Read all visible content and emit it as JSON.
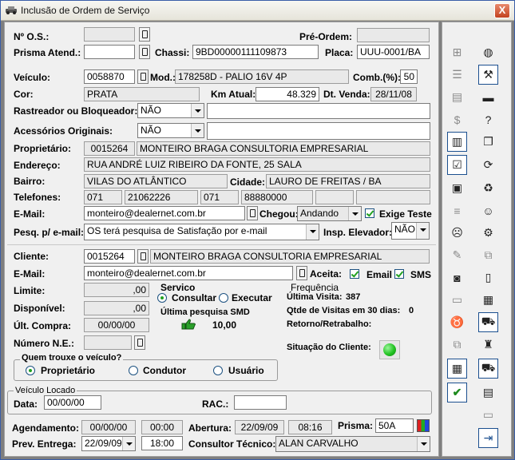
{
  "window": {
    "title": "Inclusão de Ordem de Serviço",
    "close": "X"
  },
  "labels": {
    "os": "Nº O.S.:",
    "pre_ordem": "Pré-Ordem:",
    "prisma_atend": "Prisma Atend.:",
    "chassi": "Chassi:",
    "placa": "Placa:",
    "veiculo": "Veículo:",
    "mod": "Mod.:",
    "comb": "Comb.(%):",
    "cor": "Cor:",
    "km_atual": "Km Atual:",
    "dt_venda": "Dt. Venda:",
    "rastreador": "Rastreador ou Bloqueador:",
    "acessorios": "Acessórios Originais:",
    "proprietario": "Proprietário:",
    "endereco": "Endereço:",
    "bairro": "Bairro:",
    "cidade": "Cidade:",
    "telefones": "Telefones:",
    "email": "E-Mail:",
    "chegou": "Chegou:",
    "exige_teste": "Exige Teste",
    "pesq_email": "Pesq. p/ e-mail:",
    "insp_elevador": "Insp. Elevador:",
    "cliente": "Cliente:",
    "email2": "E-Mail:",
    "aceita": "Aceita:",
    "email_chk": "Email",
    "sms_chk": "SMS",
    "limite": "Limite:",
    "disponivel": "Disponível:",
    "ult_compra": "Últ. Compra:",
    "numero_ne": "Número N.E.:",
    "servico": "Servico",
    "consultar": "Consultar",
    "executar": "Executar",
    "ultima_pesquisa": "Última pesquisa SMD",
    "frequencia": "Frequência",
    "ultima_visita": "Última Visita:",
    "qtde_visitas": "Qtde de Visitas em 30 dias:",
    "retorno": "Retorno/Retrabalho:",
    "situacao": "Situação do Cliente:",
    "quem_trouxe": "Quem trouxe o veículo?",
    "proprietario_opt": "Proprietário",
    "condutor_opt": "Condutor",
    "usuario_opt": "Usuário",
    "veiculo_locado": "Veículo Locado",
    "data": "Data:",
    "rac": "RAC.:",
    "agendamento": "Agendamento:",
    "abertura": "Abertura:",
    "prisma": "Prisma:",
    "prev_entrega": "Prev. Entrega:",
    "consultor": "Consultor Técnico:"
  },
  "values": {
    "chassi": "9BD00000111109873",
    "placa": "UUU-0001/BA",
    "veiculo": "0058870",
    "mod": "178258D - PALIO 16V 4P",
    "comb": "50",
    "cor": "PRATA",
    "km_atual": "48.329",
    "dt_venda": "28/11/08",
    "rastreador": "NÃO",
    "acessorios": "NÃO",
    "prop_code": "0015264",
    "prop_name": "MONTEIRO BRAGA CONSULTORIA EMPRESARIAL",
    "endereco": "RUA ANDRÉ LUIZ RIBEIRO DA FONTE, 25 SALA",
    "bairro": "VILAS DO ATLÂNTICO",
    "cidade": "LAURO DE FREITAS / BA",
    "tel1_ddd": "071",
    "tel1": "21062226",
    "tel2_ddd": "071",
    "tel2": "88880000",
    "email": "monteiro@dealernet.com.br",
    "chegou": "Andando",
    "pesq_email": "OS terá pesquisa de Satisfação por e-mail",
    "insp_elevador": "NÃO",
    "cliente_code": "0015264",
    "cliente_name": "MONTEIRO BRAGA CONSULTORIA EMPRESARIAL",
    "cliente_email": "monteiro@dealernet.com.br",
    "limite": ",00",
    "disponivel": ",00",
    "ult_compra": "00/00/00",
    "ultima_pesquisa_valor": "10,00",
    "ultima_visita": "387",
    "qtde_visitas": "0",
    "data_locado": "00/00/00",
    "agend_data": "00/00/00",
    "agend_hora": "00:00",
    "abertura_data": "22/09/09",
    "abertura_hora": "08:16",
    "prisma": "50A",
    "prev_data": "22/09/09",
    "prev_hora": "18:00",
    "consultor": "ALAN CARVALHO"
  },
  "colors": {
    "status_light": "#22c322",
    "title_close": "#c3421f"
  }
}
